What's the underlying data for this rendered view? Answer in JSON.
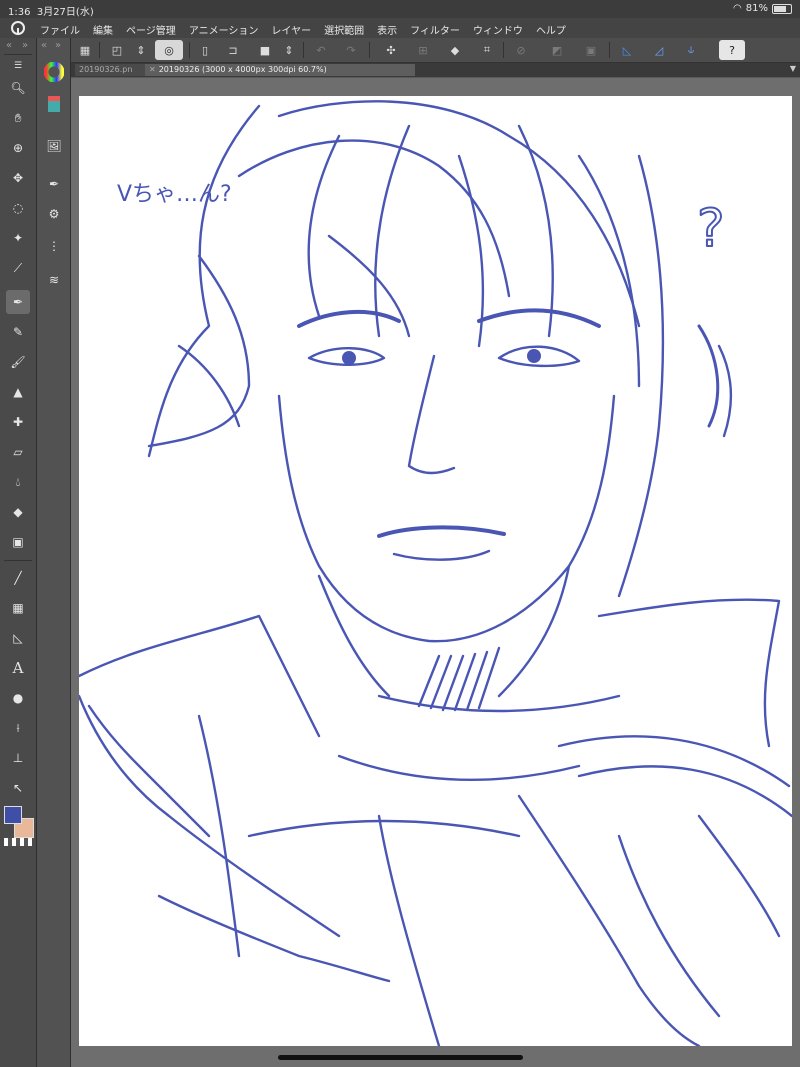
{
  "status_bar": {
    "time": "1:36",
    "date": "3月27日(水)",
    "battery": "81%"
  },
  "menu": {
    "items": [
      "ファイル",
      "編集",
      "ページ管理",
      "アニメーション",
      "レイヤー",
      "選択範囲",
      "表示",
      "フィルター",
      "ウィンドウ",
      "ヘルプ"
    ]
  },
  "tabs": [
    {
      "label": "20190326.pn"
    },
    {
      "label": "20190326 (3000 x 4000px 300dpi 60.7%)"
    }
  ],
  "canvas_text": {
    "note": "Vちゃ…ん?",
    "question": "?"
  },
  "colors": {
    "stroke": "#4a56b4",
    "main": "#3f4ea6",
    "sub": "#e8b898",
    "accent": "#2b6fd6"
  },
  "tools": [
    "zoom-icon",
    "hand-icon",
    "operation-icon",
    "move-icon",
    "lasso-icon",
    "select-icon",
    "eyedropper-icon",
    "pen-icon",
    "pencil-icon",
    "brush-icon",
    "airbrush-icon",
    "decoration-icon",
    "eraser-icon",
    "blend-icon",
    "fill-icon",
    "gradient-icon",
    "line-icon",
    "frame-icon",
    "ruler-icon",
    "text-icon",
    "balloon-icon",
    "correction-icon",
    "sub-tool-icon",
    "arrow-icon"
  ]
}
